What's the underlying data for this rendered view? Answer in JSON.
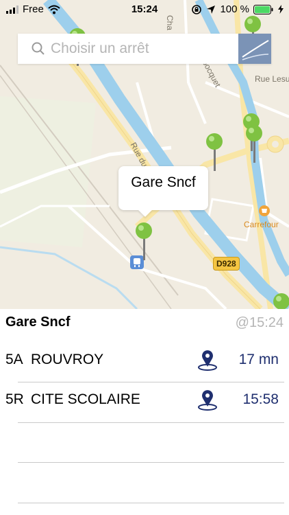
{
  "status_bar": {
    "carrier": "Free",
    "time": "15:24",
    "battery_percent": "100 %",
    "icons": [
      "signal-icon",
      "wifi-icon",
      "lock-rotation-icon",
      "location-arrow-icon",
      "battery-icon",
      "charging-bolt-icon"
    ]
  },
  "search": {
    "placeholder": "Choisir un arrêt"
  },
  "map": {
    "street_labels": [
      "Rue du Ca",
      "Cha",
      "bocquet",
      "Rue Lesu"
    ],
    "poi_label": "Carrefour",
    "road_number": "D928",
    "callout_title": "Gare Sncf",
    "colors": {
      "water": "#9dcfec",
      "land": "#f1ece1",
      "road": "#f9e6a6",
      "pin": "#7fc242",
      "poi": "#f0a43a"
    }
  },
  "stop": {
    "name": "Gare Sncf",
    "updated_at": "@15:24"
  },
  "departures": [
    {
      "line": "5A",
      "destination": "ROUVROY",
      "wait": "17 mn"
    },
    {
      "line": "5R",
      "destination": "CITE SCOLAIRE",
      "wait": "15:58"
    }
  ]
}
